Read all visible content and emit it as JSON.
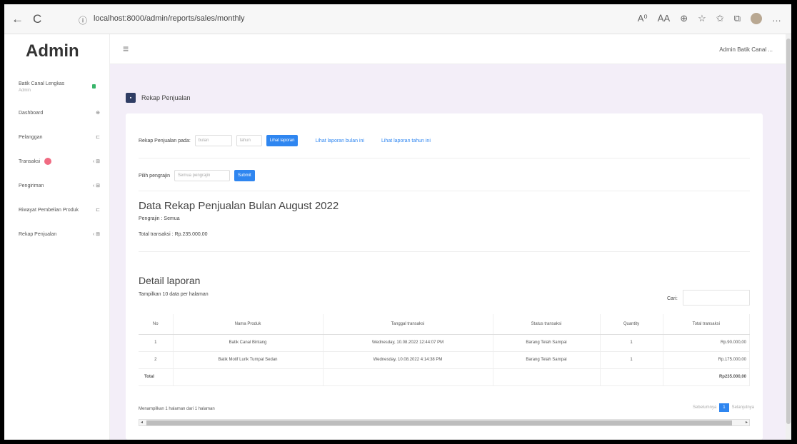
{
  "browser": {
    "back": "←",
    "reload": "C",
    "info": "ⓘ",
    "url": "localhost:8000/admin/reports/sales/monthly",
    "icons": [
      "A⁰",
      "ꓮA",
      "⊕",
      "☆",
      "✩",
      "⧉",
      "…"
    ]
  },
  "sidebar": {
    "brand": "Admin",
    "user_name": "Batik Canal Lengkas",
    "user_role": "Admin",
    "items": [
      {
        "label": "Dashboard",
        "arrow": "⊕"
      },
      {
        "label": "Pelanggan",
        "arrow": "⊏"
      },
      {
        "label": "Transaksi",
        "arrow": "‹ ⊞",
        "badge": true
      },
      {
        "label": "Pengiriman",
        "arrow": "‹ ⊞"
      },
      {
        "label": "Riwayat Pembelian Produk",
        "arrow": "⊏"
      },
      {
        "label": "Rekap Penjualan",
        "arrow": "‹ ⊞"
      }
    ]
  },
  "topbar": {
    "menu_icon": "≡",
    "user": "Admin Batik Canal ..."
  },
  "page": {
    "title_icon": "▪",
    "title": "Rekap Penjualan",
    "filter": {
      "label": "Rekap Penjualan pada:",
      "month_placeholder": "bulan",
      "year_placeholder": "tahun",
      "button": "Lihat laporan",
      "link1": "Lihat laporan bulan ini",
      "link2": "Lihat laporan tahun ini"
    },
    "craftsman": {
      "label": "Pilih pengrajin",
      "placeholder": "Semua pengrajin",
      "button": "Submit"
    },
    "report_title": "Data Rekap Penjualan Bulan August 2022",
    "pengrajin": "Pengrajin : Semua",
    "total": "Total transaksi : Rp.235.000,00",
    "detail_title": "Detail laporan",
    "tampilkan": "Tampilkan  10  data per halaman",
    "cari_label": "Cari:",
    "table": {
      "headers": [
        "No",
        "Nama Produk",
        "Tanggal transaksi",
        "Status transaksi",
        "Quantity",
        "Total transaksi"
      ],
      "rows": [
        [
          "1",
          "Batik Canal Bintang",
          "Wednesday, 10.08.2022 12:44:07 PM",
          "Barang Telah Sampai",
          "1",
          "Rp.90.000,00"
        ],
        [
          "2",
          "Batik Motif Lurik Tumpal Sedan",
          "Wednesday, 10.08.2022 4:14:38 PM",
          "Barang Telah Sampai",
          "1",
          "Rp.175.000,00"
        ]
      ],
      "total_label": "Total",
      "total_value": "Rp235.000,00"
    },
    "info": "Menampilkan 1 halaman dari 1 halaman",
    "pager": {
      "prev": "Sebelumnya",
      "current": "1",
      "next": "Selanjutnya"
    }
  }
}
